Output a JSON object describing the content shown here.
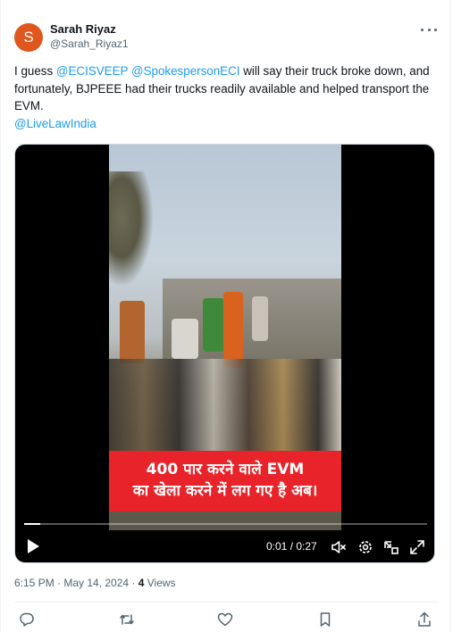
{
  "author": {
    "avatar_letter": "S",
    "name": "Sarah Riyaz",
    "handle": "@Sarah_Riyaz1"
  },
  "tweet": {
    "text_1": "I guess ",
    "mention_1": "@ECISVEEP",
    "space_1": " ",
    "mention_2": "@SpokespersonECI",
    "text_2": " will say their truck broke down, and fortunately, BJPEEE had their trucks readily available and helped transport the EVM.",
    "mention_3": "@LiveLawIndia"
  },
  "video": {
    "caption_line_1": "400 पार करने वाले EVM",
    "caption_line_2": "का खेला करने में लग गए है अब।",
    "time": "0:01 / 0:27",
    "progress_fraction": 0.04
  },
  "meta": {
    "timestamp": "6:15 PM · May 14, 2024 · ",
    "views_count": "4",
    "views_label": " Views"
  },
  "colors": {
    "link": "#1d9bf0",
    "muted": "#536471",
    "caption_bg": "#e8242a",
    "avatar_bg": "#e0561f"
  },
  "icons": [
    "more-icon",
    "play-icon",
    "volume-icon",
    "settings-icon",
    "pip-icon",
    "fullscreen-icon",
    "reply-icon",
    "retweet-icon",
    "like-icon",
    "bookmark-icon",
    "share-icon"
  ]
}
